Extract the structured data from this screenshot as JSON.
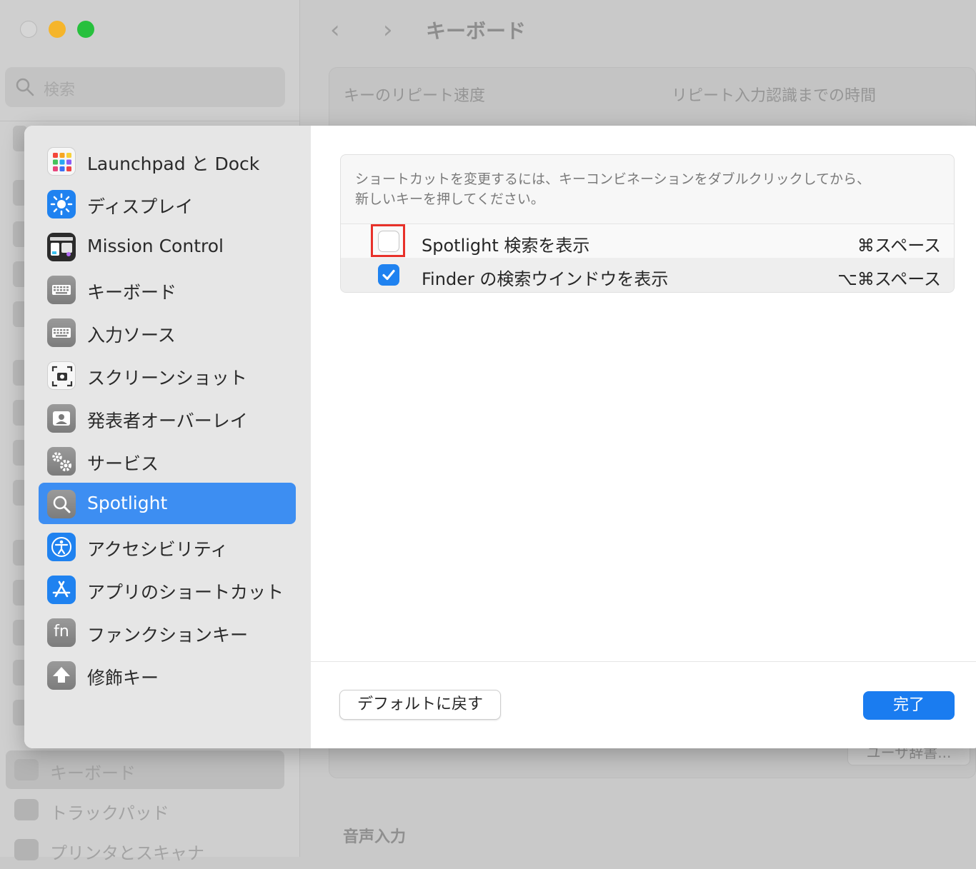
{
  "background": {
    "search_placeholder": "検索",
    "sidebar_bottom_items": [
      {
        "label": "キーボード",
        "selected": true
      },
      {
        "label": "トラックパッド",
        "selected": false
      },
      {
        "label": "プリンタとスキャナ",
        "selected": false
      }
    ],
    "header": {
      "back": "‹",
      "forward": "›",
      "title": "キーボード"
    },
    "key_repeat_label": "キーのリピート速度",
    "delay_label": "リピート入力認識までの時間",
    "dictionary_button": "ユーザ辞書...",
    "voice_input_label": "音声入力"
  },
  "sheet": {
    "categories": [
      {
        "label": "Launchpad と Dock",
        "icon": "launchpad-icon",
        "selected": false
      },
      {
        "label": "ディスプレイ",
        "icon": "display-brightness-icon",
        "selected": false
      },
      {
        "label": "Mission Control",
        "icon": "mission-control-icon",
        "selected": false
      },
      {
        "label": "キーボード",
        "icon": "keyboard-icon",
        "selected": false
      },
      {
        "label": "入力ソース",
        "icon": "input-source-icon",
        "selected": false
      },
      {
        "label": "スクリーンショット",
        "icon": "screenshot-icon",
        "selected": false
      },
      {
        "label": "発表者オーバーレイ",
        "icon": "presenter-overlay-icon",
        "selected": false
      },
      {
        "label": "サービス",
        "icon": "services-gear-icon",
        "selected": false
      },
      {
        "label": "Spotlight",
        "icon": "spotlight-search-icon",
        "selected": true
      },
      {
        "label": "アクセシビリティ",
        "icon": "accessibility-icon",
        "selected": false
      },
      {
        "label": "アプリのショートカット",
        "icon": "app-store-icon",
        "selected": false
      },
      {
        "label": "ファンクションキー",
        "icon": "fn-key-icon",
        "selected": false
      },
      {
        "label": "修飾キー",
        "icon": "modifier-arrow-icon",
        "selected": false
      }
    ],
    "fn_glyph": "fn",
    "description_line1": "ショートカットを変更するには、キーコンビネーションをダブルクリックしてから、",
    "description_line2": "新しいキーを押してください。",
    "shortcuts": [
      {
        "name": "Spotlight 検索を表示",
        "keys": "⌘スペース",
        "checked": false
      },
      {
        "name": "Finder の検索ウインドウを表示",
        "keys": "⌥⌘スペース",
        "checked": true
      }
    ],
    "restore_defaults_label": "デフォルトに戻す",
    "done_label": "完了"
  },
  "colors": {
    "accent": "#1a7cf0",
    "highlight_box": "#e8312a",
    "selected_row": "#3d8ef2"
  }
}
